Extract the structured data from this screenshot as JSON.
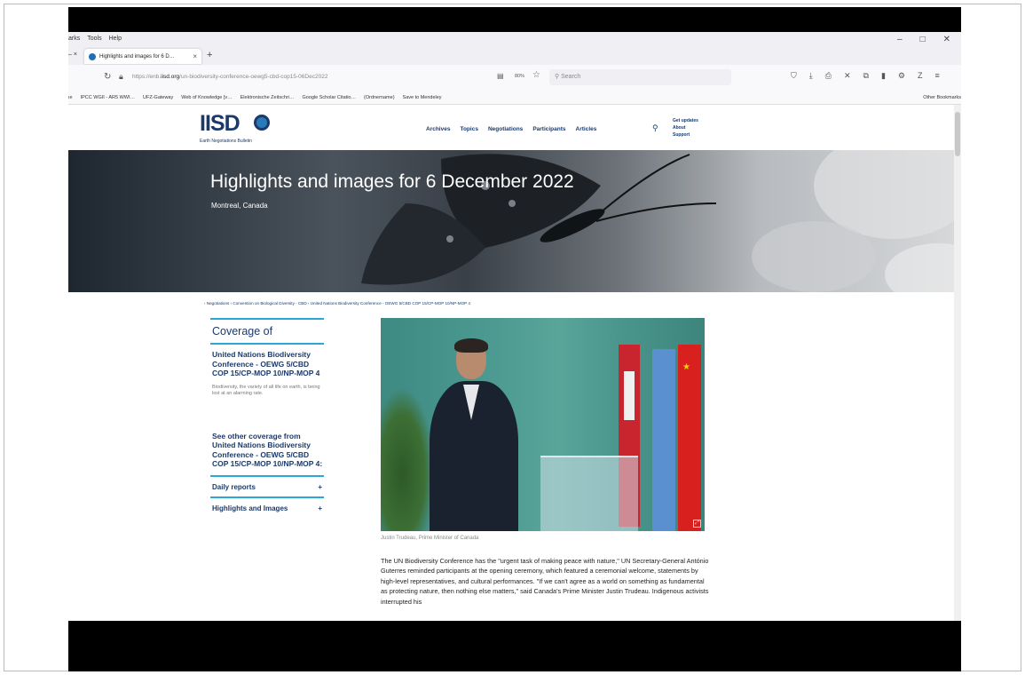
{
  "browser": {
    "menu_items": [
      "arks",
      "Tools",
      "Help"
    ],
    "window_controls": [
      "–",
      "□",
      "✕"
    ],
    "prev_tab_fragment": "– ×",
    "active_tab_title": "Highlights and images for 6 D…",
    "active_tab_close": "×",
    "new_tab": "+",
    "url_prefix": "https://enb.",
    "url_domain": "iisd.org",
    "url_path": "/un-biodiversity-conference-oewg5-cbd-cop15-06Dec2022",
    "zoom": "80%",
    "search_placeholder": "Search",
    "bookmarks": [
      "ıe",
      "IPCC WGII - AR5 WWI…",
      "UFZ-Gateway",
      "Web of Knowledge [v…",
      "Elektronische Zeitschri…",
      "Google Scholar Citatio…",
      "(Ordnername)",
      "Save to Mendeley"
    ],
    "other_bookmarks": "Other Bookmarks"
  },
  "site": {
    "logo": "IISD",
    "logo_sub": "Earth Negotiations Bulletin",
    "nav": [
      "Archives",
      "Topics",
      "Negotiations",
      "Participants",
      "Articles"
    ],
    "side_links": [
      "Get updates",
      "About",
      "Support"
    ]
  },
  "hero": {
    "title": "Highlights and images for 6 December 2022",
    "location": "Montreal, Canada"
  },
  "breadcrumb": "‹ Negotiations  ‹ Convention on Biological Diversity - CBD  ‹ United Nations Biodiversity Conference - OEWG 5/CBD COP 15/CP-MOP 10/NP-MOP 4",
  "sidebar": {
    "heading": "Coverage of",
    "conference": "United Nations Biodiversity Conference - OEWG 5/CBD COP 15/CP-MOP 10/NP-MOP 4",
    "description": "Biodiversity, the variety of all life on earth, is being lost at an alarming rate.",
    "see_other": "See other coverage from United Nations Biodiversity Conference - OEWG 5/CBD COP 15/CP-MOP 10/NP-MOP 4:",
    "items": [
      {
        "label": "Daily reports",
        "toggle": "+"
      },
      {
        "label": "Highlights and Images",
        "toggle": "+"
      }
    ]
  },
  "article": {
    "caption": "Justin Trudeau, Prime Minister of Canada",
    "body": "The UN Biodiversity Conference has the \"urgent task of making peace with nature,\" UN Secretary-General António Guterres reminded participants at the opening ceremony, which featured a ceremonial welcome, statements by high-level representatives, and cultural performances. \"If we can't agree as a world on something as fundamental as protecting nature, then nothing else matters,\" said Canada's Prime Minister Justin Trudeau. Indigenous activists interrupted his"
  },
  "colors": {
    "brand_navy": "#1b3a6b",
    "accent_blue": "#29a8d6",
    "letterbox": "#000000"
  }
}
